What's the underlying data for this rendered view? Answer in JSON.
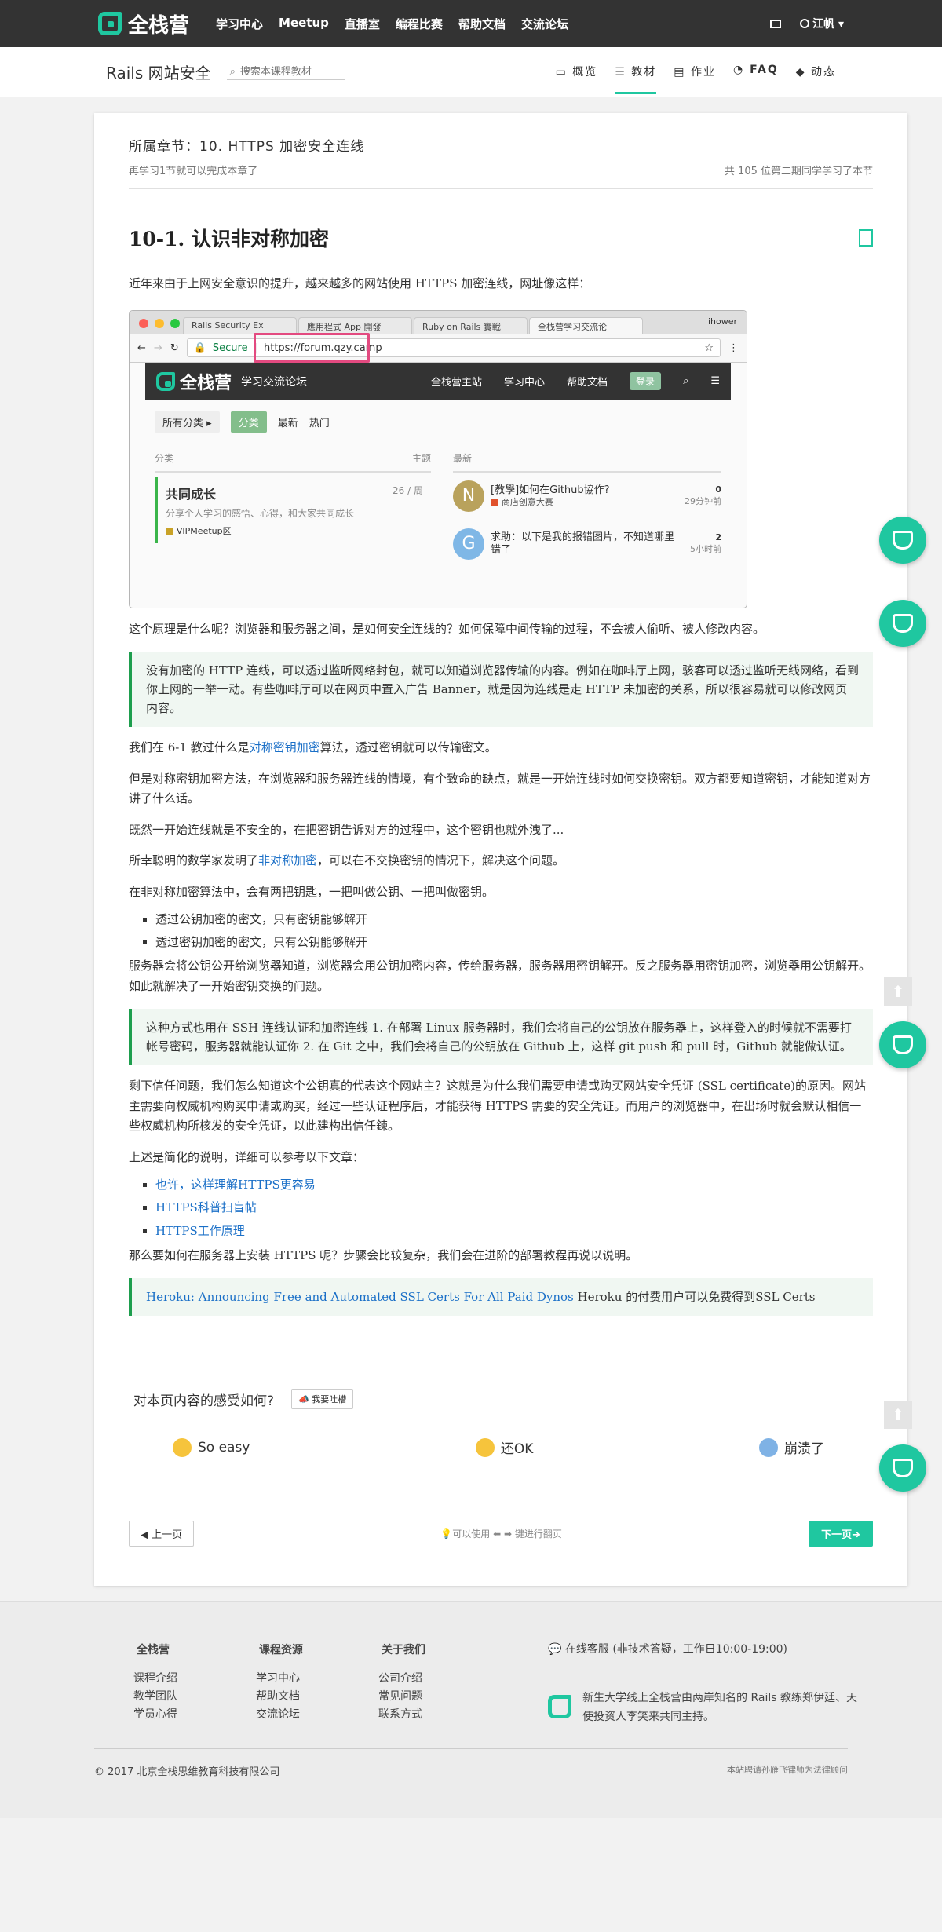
{
  "nav": {
    "brand": "全栈营",
    "items": [
      "学习中心",
      "Meetup",
      "直播室",
      "编程比赛",
      "帮助文档",
      "交流论坛"
    ],
    "user": "江帆"
  },
  "course": {
    "title": "Rails 网站安全",
    "search_placeholder": "搜索本课程教材",
    "tabs": [
      "概览",
      "教材",
      "作业",
      "FAQ",
      "动态"
    ],
    "active_tab": "教材"
  },
  "chapter": {
    "title": "所属章节：10. HTTPS 加密安全连线",
    "progress_left": "再学习1节就可以完成本章了",
    "progress_right": "共 105 位第二期同学学习了本节"
  },
  "lesson": {
    "title": "10-1. 认识非对称加密",
    "intro": "近年来由于上网安全意识的提升，越来越多的网站使用 HTTPS 加密连线，网址像这样：",
    "browser": {
      "tabs": [
        "Rails Security Ex",
        "應用程式 App 開發",
        "Ruby on Rails 實戰",
        "全栈营学习交流论"
      ],
      "user": "ihower",
      "secure": "Secure",
      "url": "https://forum.qzy.camp",
      "site_brand": "全栈营",
      "site_sub": "学习交流论坛",
      "site_links": [
        "全栈营主站",
        "学习中心",
        "帮助文档"
      ],
      "login": "登录",
      "filters": [
        "所有分类",
        "分类",
        "最新",
        "热门"
      ],
      "col_category": "分类",
      "col_topics": "主题",
      "col_latest": "最新",
      "category": {
        "name": "共同成长",
        "count": "26 / 周",
        "desc": "分享个人学习的感悟、心得，和大家共同成长",
        "tag": "VIPMeetup区"
      },
      "topics": [
        {
          "avatar": "N",
          "title": "[教學]如何在Github協作?",
          "tag": "商店创意大赛",
          "replies": "0",
          "time": "29分钟前",
          "color": "#b9a25c"
        },
        {
          "avatar": "G",
          "title": "求助：以下是我的报错图片，不知道哪里错了",
          "tag": "",
          "replies": "2",
          "time": "5小时前",
          "color": "#7fb7e6"
        }
      ]
    },
    "p1": "这个原理是什么呢？浏览器和服务器之间，是如何安全连线的？如何保障中间传输的过程，不会被人偷听、被人修改内容。",
    "quote1": "没有加密的 HTTP 连线，可以透过监听网络封包，就可以知道浏览器传输的内容。例如在咖啡厅上网，骇客可以透过监听无线网络，看到你上网的一举一动。有些咖啡厅可以在网页中置入广告 Banner，就是因为连线是走 HTTP 未加密的关系，所以很容易就可以修改网页内容。",
    "p2_pre": "我们在 6-1 教过什么是",
    "p2_link": "对称密钥加密",
    "p2_post": "算法，透过密钥就可以传输密文。",
    "p3": "但是对称密钥加密方法，在浏览器和服务器连线的情境，有个致命的缺点，就是一开始连线时如何交换密钥。双方都要知道密钥，才能知道对方讲了什么话。",
    "p4": "既然一开始连线就是不安全的，在把密钥告诉对方的过程中，这个密钥也就外洩了...",
    "p5_pre": "所幸聪明的数学家发明了",
    "p5_link": "非对称加密",
    "p5_post": "，可以在不交换密钥的情况下，解决这个问题。",
    "p6": "在非对称加密算法中，会有两把钥匙，一把叫做公钥、一把叫做密钥。",
    "bullets": [
      "透过公钥加密的密文，只有密钥能够解开",
      "透过密钥加密的密文，只有公钥能够解开"
    ],
    "p7": "服务器会将公钥公开给浏览器知道，浏览器会用公钥加密内容，传给服务器，服务器用密钥解开。反之服务器用密钥加密，浏览器用公钥解开。如此就解决了一开始密钥交换的问题。",
    "quote2": "这种方式也用在 SSH 连线认证和加密连线 1. 在部署 Linux 服务器时，我们会将自己的公钥放在服务器上，这样登入的时候就不需要打帐号密码，服务器就能认证你 2. 在 Git 之中，我们会将自己的公钥放在 Github 上，这样 git push 和 pull 时，Github 就能做认证。",
    "p8": "剩下信任问题，我们怎么知道这个公钥真的代表这个网站主？这就是为什么我们需要申请或购买网站安全凭证 (SSL certificate)的原因。网站主需要向权威机构购买申请或购买，经过一些认证程序后，才能获得 HTTPS 需要的安全凭证。而用户的浏览器中，在出场时就会默认相信一些权威机构所核发的安全凭证，以此建构出信任鍊。",
    "p9": "上述是简化的说明，详细可以参考以下文章：",
    "links": [
      "也许，这样理解HTTPS更容易",
      "HTTPS科普扫盲帖",
      "HTTPS工作原理"
    ],
    "p10": "那么要如何在服务器上安装 HTTPS 呢？步骤会比较复杂，我们会在进阶的部署教程再说以说明。",
    "quote3_link": "Heroku: Announcing Free and Automated SSL Certs For All Paid Dynos",
    "quote3_text": " Heroku 的付费用户可以免费得到SSL Certs"
  },
  "feedback": {
    "question": "对本页内容的感受如何?",
    "button": "我要吐槽",
    "options": [
      "So easy",
      "还OK",
      "崩溃了"
    ]
  },
  "pager": {
    "prev": "上一页",
    "hint_pre": "可以使用",
    "hint_post": "键进行翻页",
    "next": "下一页"
  },
  "footer": {
    "col1": {
      "title": "全栈营",
      "items": [
        "课程介绍",
        "教学团队",
        "学员心得"
      ]
    },
    "col2": {
      "title": "课程资源",
      "items": [
        "学习中心",
        "帮助文档",
        "交流论坛"
      ]
    },
    "col3": {
      "title": "关于我们",
      "items": [
        "公司介绍",
        "常见问题",
        "联系方式"
      ]
    },
    "service": "在线客服 (非技术答疑，工作日10:00-19:00)",
    "intro": "新生大学线上全栈营由两岸知名的 Rails 教练郑伊廷、天使投资人李笑来共同主持。",
    "copyright": "© 2017 北京全栈思维教育科技有限公司",
    "law": "本站聘请孙雁飞律师为法律顾问"
  },
  "colors": {
    "accent": "#1fc7a0",
    "nav_bg": "#333333",
    "quote_border": "#1e9e4e",
    "link": "#1a6fc7"
  }
}
